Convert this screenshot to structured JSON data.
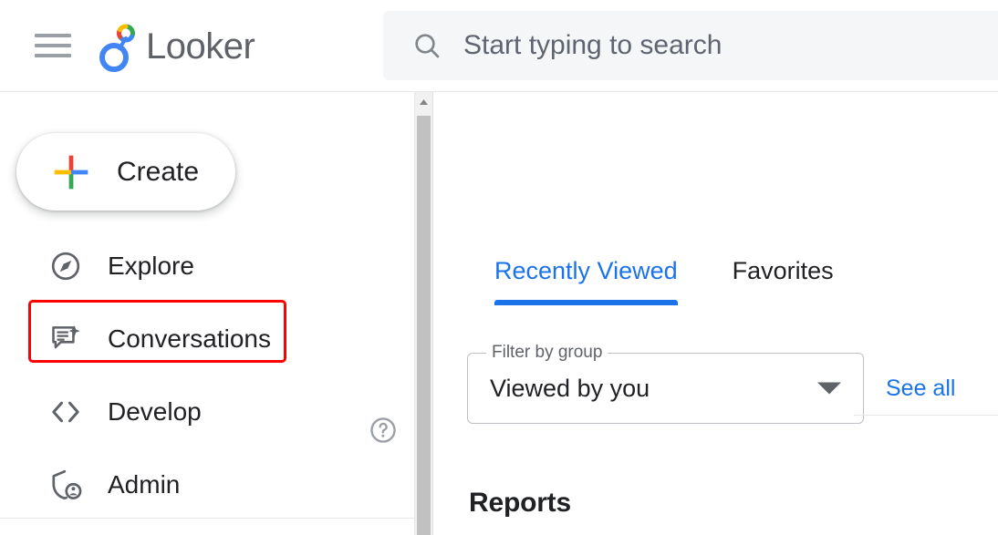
{
  "header": {
    "menu_icon": "hamburger-menu-icon",
    "brand": "Looker",
    "logo_icon": "looker-logo-icon",
    "search": {
      "icon": "search-icon",
      "placeholder": "Start typing to search",
      "value": ""
    }
  },
  "sidebar": {
    "create": {
      "label": "Create",
      "icon": "plus-icon"
    },
    "items": [
      {
        "label": "Explore",
        "icon": "compass-icon",
        "highlighted": false
      },
      {
        "label": "Conversations",
        "icon": "chat-sparkle-icon",
        "highlighted": true
      },
      {
        "label": "Develop",
        "icon": "code-brackets-icon",
        "highlighted": false
      },
      {
        "label": "Admin",
        "icon": "shield-person-icon",
        "highlighted": false
      }
    ],
    "help": {
      "icon": "help-circle-icon",
      "label": "?"
    },
    "highlight_color": "#ff0000"
  },
  "scrollbar": {
    "up_arrow_icon": "chevron-up-icon",
    "orientation": "vertical"
  },
  "main": {
    "tabs": [
      {
        "label": "Recently Viewed",
        "active": true
      },
      {
        "label": "Favorites",
        "active": false
      }
    ],
    "filter": {
      "legend": "Filter by group",
      "value": "Viewed by you",
      "arrow_icon": "chevron-down-icon"
    },
    "see_all": "See all",
    "section_heading": "Reports"
  },
  "colors": {
    "accent_blue": "#1a73e8",
    "text_primary": "#202124",
    "text_secondary": "#5f6368",
    "border": "#e4e6e8",
    "search_bg": "#f4f6f8",
    "highlight_red": "#ff0000",
    "google_red": "#ea4335",
    "google_yellow": "#fbbc04",
    "google_green": "#34a853",
    "google_blue": "#4285f4"
  }
}
